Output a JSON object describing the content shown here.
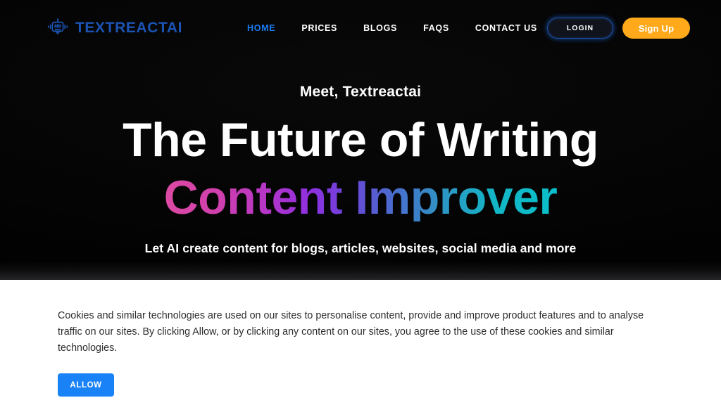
{
  "brand": {
    "name": "TEXTREACTAI",
    "icon": "robot-icon",
    "color": "#1b54b5"
  },
  "nav": {
    "links": [
      {
        "label": "HOME",
        "active": true
      },
      {
        "label": "PRICES",
        "active": false
      },
      {
        "label": "BLOGS",
        "active": false
      },
      {
        "label": "FAQS",
        "active": false
      },
      {
        "label": "CONTACT US",
        "active": false
      }
    ],
    "active_color": "#1a7cf5",
    "login_label": "LOGIN",
    "signup_label": "Sign Up",
    "signup_color": "#ffa91b",
    "login_border_color": "#1f4f9e"
  },
  "hero": {
    "eyebrow": "Meet, Textreactai",
    "headline": "The Future of Writing",
    "headline_gradient": "Content Improver",
    "gradient_start": "#dc4aa2",
    "gradient_mid": "#8f2fe0",
    "gradient_end": "#0bbfca",
    "subhead": "Let AI create content for blogs, articles, websites, social media and more",
    "background_color": "#000000"
  },
  "cookie_banner": {
    "text": "Cookies and similar technologies are used on our sites to personalise content, provide and improve product features and to analyse traffic on our sites. By clicking Allow, or by clicking any content on our sites, you agree to the use of these cookies and similar technologies.",
    "allow_label": "ALLOW",
    "allow_color": "#1a82f7",
    "background_color": "#ffffff"
  }
}
